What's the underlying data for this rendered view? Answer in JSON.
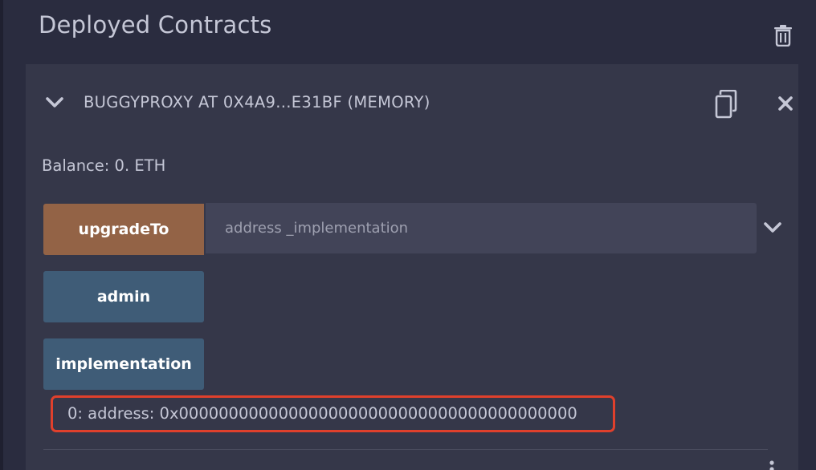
{
  "section": {
    "title": "Deployed Contracts"
  },
  "contract": {
    "title": "BUGGYPROXY AT 0X4A9...E31BF (MEMORY)",
    "balance": "Balance: 0. ETH"
  },
  "functions": {
    "upgrade_label": "upgradeTo",
    "upgrade_placeholder": "address _implementation",
    "admin_label": "admin",
    "implementation_label": "implementation"
  },
  "result": {
    "text": "0: address: 0x0000000000000000000000000000000000000000"
  },
  "colors": {
    "background": "#2a2c3f",
    "panel": "#353749",
    "transact_button": "#936346",
    "call_button": "#3f5c77",
    "input": "#424458",
    "highlight_border": "#e0402c",
    "text": "#c5c7d6"
  },
  "icons": {
    "trash": "trash-icon",
    "chevron_down": "chevron-down-icon",
    "copy": "copy-icon",
    "close": "close-icon",
    "kebab": "kebab-menu-icon"
  }
}
